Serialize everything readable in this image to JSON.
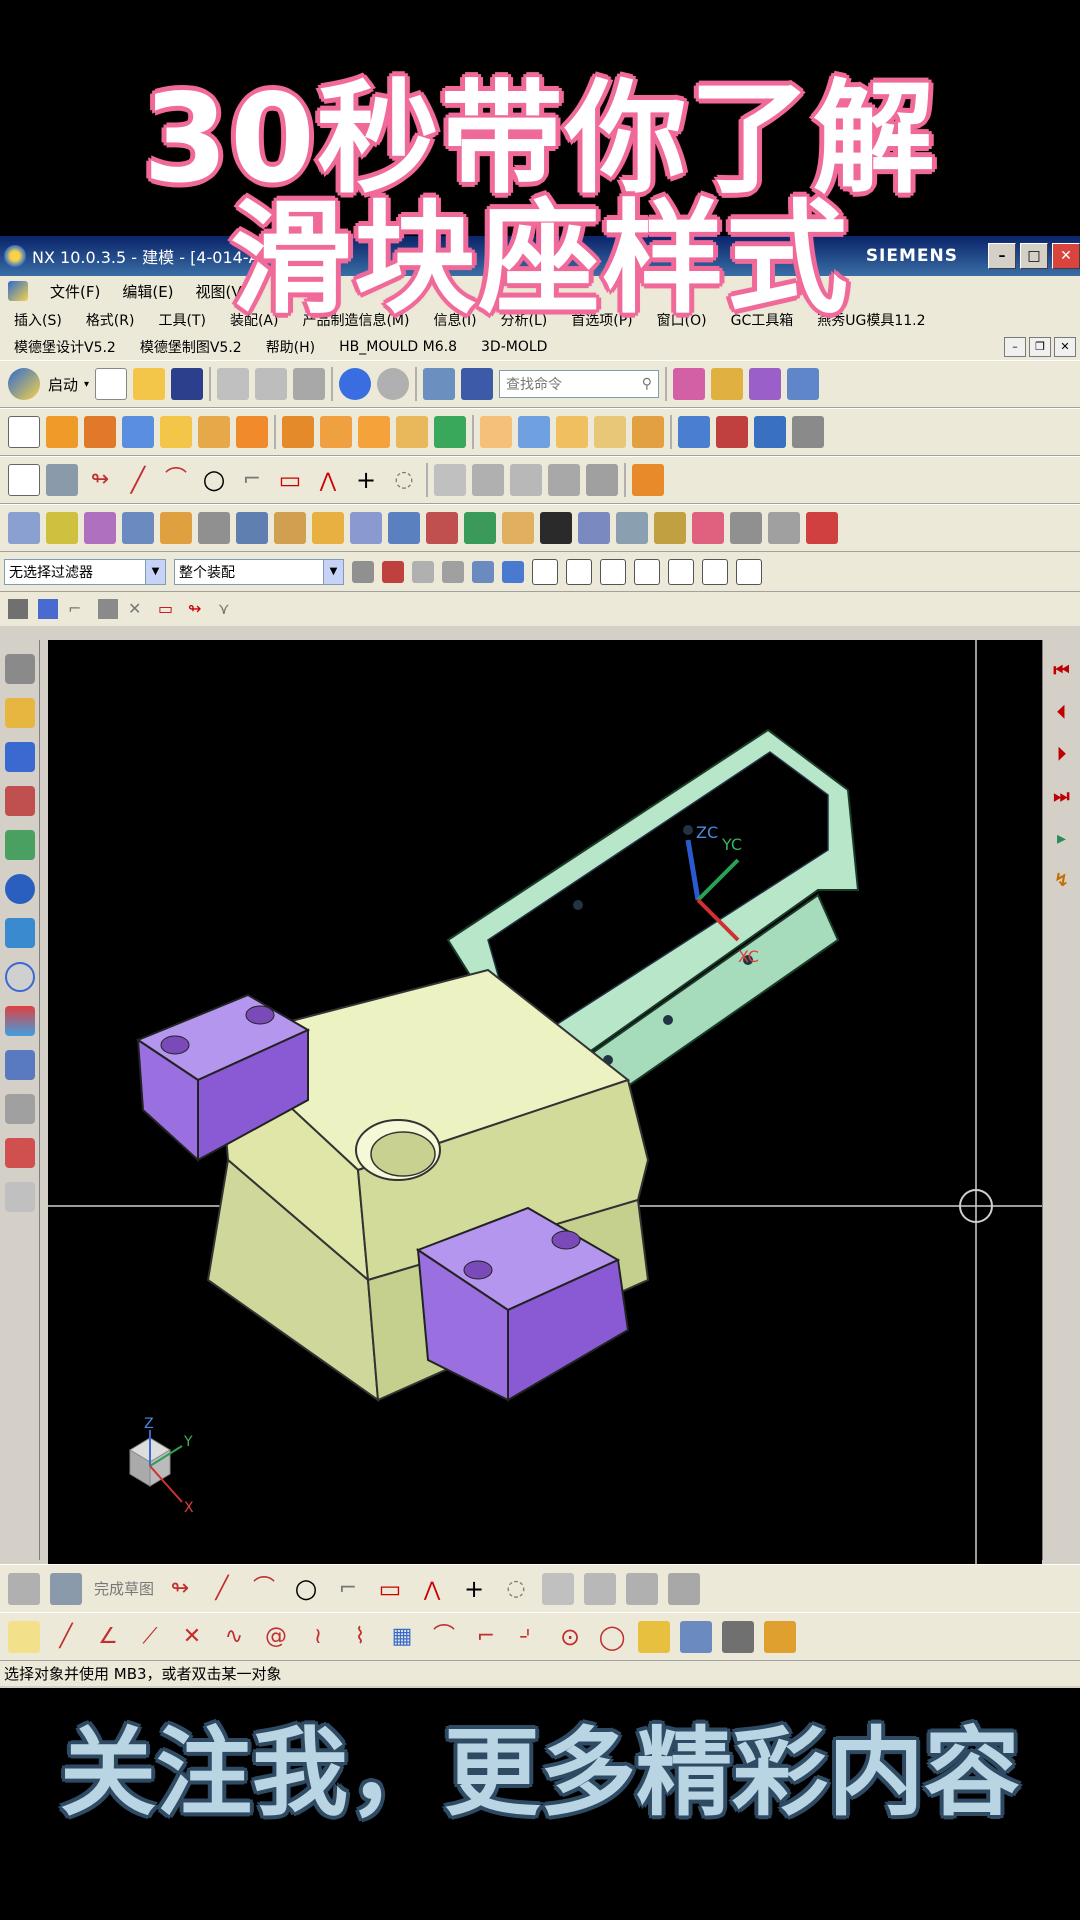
{
  "overlay": {
    "title_line1": "30秒带你了解",
    "title_line2": "滑块座样式",
    "bottom_caption": "关注我，更多精彩内容"
  },
  "window": {
    "title": "NX 10.0.3.5 - 建模 - [4-014-A",
    "brand": "SIEMENS",
    "min_glyph": "–",
    "max_glyph": "□",
    "close_glyph": "✕"
  },
  "menubar": {
    "items": [
      "文件(F)",
      "编辑(E)",
      "视图(V)"
    ]
  },
  "menu_row2": {
    "items": [
      "插入(S)",
      "格式(R)",
      "工具(T)",
      "装配(A)",
      "产品制造信息(M)",
      "信息(I)",
      "分析(L)",
      "首选项(P)",
      "窗口(O)",
      "GC工具箱",
      "燕秀UG模具11.2"
    ]
  },
  "menu_row3": {
    "items": [
      "模德堡设计V5.2",
      "模德堡制图V5.2",
      "帮助(H)",
      "HB_MOULD M6.8",
      "3D-MOLD"
    ]
  },
  "toolbar": {
    "start_label": "启动",
    "search_placeholder": "查找命令"
  },
  "filters": {
    "selection_filter": "无选择过滤器",
    "scope": "整个装配"
  },
  "sketch_toolbar": {
    "finish_sketch_label": "完成草图"
  },
  "status": {
    "text": "选择对象并使用 MB3，或者双击某一对象"
  },
  "viewport": {
    "wcs_labels": [
      "ZC",
      "YC",
      "XC"
    ],
    "triad_labels": [
      "Z",
      "Y",
      "X"
    ]
  },
  "colors": {
    "block_body": "#e9efb6",
    "clamp_parts": "#9a6fe0",
    "frame": "#b7e6c9",
    "background": "#000000",
    "title_outline": "#f06a9a"
  }
}
